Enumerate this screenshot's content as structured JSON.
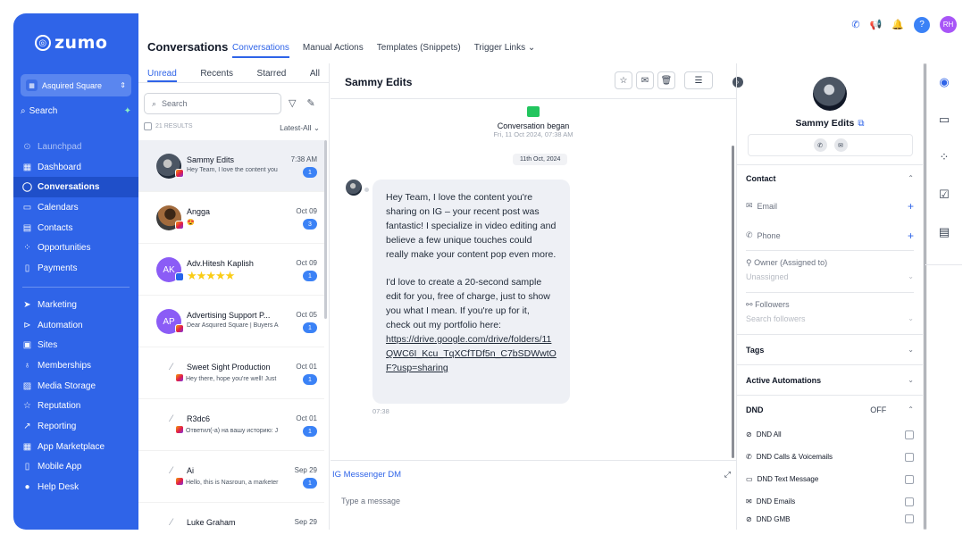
{
  "sidebar": {
    "logo": "zumo",
    "account": "Asquired Square",
    "search": "Search",
    "items_top": [
      {
        "label": "Launchpad",
        "icon": "rocket-icon"
      },
      {
        "label": "Dashboard",
        "icon": "dashboard-icon"
      },
      {
        "label": "Conversations",
        "icon": "chat-icon"
      },
      {
        "label": "Calendars",
        "icon": "calendar-icon"
      },
      {
        "label": "Contacts",
        "icon": "contacts-icon"
      },
      {
        "label": "Opportunities",
        "icon": "opportunities-icon"
      },
      {
        "label": "Payments",
        "icon": "payments-icon"
      }
    ],
    "items_bottom": [
      {
        "label": "Marketing",
        "icon": "send-icon"
      },
      {
        "label": "Automation",
        "icon": "automation-icon"
      },
      {
        "label": "Sites",
        "icon": "sites-icon"
      },
      {
        "label": "Memberships",
        "icon": "memberships-icon"
      },
      {
        "label": "Media Storage",
        "icon": "media-icon"
      },
      {
        "label": "Reputation",
        "icon": "star-icon"
      },
      {
        "label": "Reporting",
        "icon": "reporting-icon"
      },
      {
        "label": "App Marketplace",
        "icon": "marketplace-icon"
      },
      {
        "label": "Mobile App",
        "icon": "mobile-icon"
      },
      {
        "label": "Help Desk",
        "icon": "help-icon"
      }
    ]
  },
  "header": {
    "title": "Conversations",
    "tabs": [
      "Conversations",
      "Manual Actions",
      "Templates (Snippets)",
      "Trigger Links"
    ],
    "user_initials": "RH",
    "help": "?"
  },
  "list": {
    "tabs": [
      "Unread",
      "Recents",
      "Starred",
      "All"
    ],
    "search_placeholder": "Search",
    "results": "21 RESULTS",
    "sort": "Latest-All",
    "items": [
      {
        "name": "Sammy Edits",
        "time": "7:38 AM",
        "preview": "Hey Team, I love the content you",
        "badge": "1"
      },
      {
        "name": "Angga",
        "time": "Oct 09",
        "preview": "😍",
        "badge": "3"
      },
      {
        "name": "Adv.Hitesh Kaplish",
        "initials": "AK",
        "time": "Oct 09",
        "preview": "★★★★★",
        "badge": "1"
      },
      {
        "name": "Advertising Support P...",
        "initials": "AP",
        "time": "Oct 05",
        "preview": "Dear Asquired Square | Buyers A",
        "badge": "1"
      },
      {
        "name": "Sweet Sight Production",
        "time": "Oct 01",
        "preview": "Hey there, hope you're well! Just",
        "badge": "1"
      },
      {
        "name": "R3dc6",
        "time": "Oct 01",
        "preview": "Ответил(-а) на вашу историю: J",
        "badge": "1"
      },
      {
        "name": "Ai",
        "time": "Sep 29",
        "preview": "Hello, this is Nasroun, a marketer",
        "badge": "1"
      },
      {
        "name": "Luke Graham",
        "time": "Sep 29",
        "preview": "",
        "badge": ""
      }
    ]
  },
  "chat": {
    "title": "Sammy Edits",
    "began_title": "Conversation began",
    "began_date": "Fri, 11 Oct 2024, 07:38 AM",
    "date_pill": "11th Oct, 2024",
    "message_p1": "Hey Team, I love the content you're sharing on IG – your recent post was fantastic! I specialize in video editing and believe a few unique touches could really make your content pop even more.",
    "message_p2": "I'd love to create a 20-second sample edit for you, free of charge, just to show you what I mean. If you're up for it, check out my portfolio here:",
    "message_link": "https://drive.google.com/drive/folders/11QWC6I_Kcu_TqXCfTDf5n_C7bSDWwtOF?usp=sharing",
    "message_time": "07:38",
    "channel": "IG Messenger DM",
    "compose_placeholder": "Type a message"
  },
  "contact": {
    "name": "Sammy Edits",
    "section_contact": "Contact",
    "email_label": "Email",
    "phone_label": "Phone",
    "owner_label": "Owner (Assigned to)",
    "owner_value": "Unassigned",
    "followers_label": "Followers",
    "followers_placeholder": "Search followers",
    "tags": "Tags",
    "automations": "Active Automations",
    "dnd": "DND",
    "dnd_state": "OFF",
    "dnd_items": [
      "DND All",
      "DND Calls & Voicemails",
      "DND Text Message",
      "DND Emails",
      "DND GMB"
    ]
  }
}
